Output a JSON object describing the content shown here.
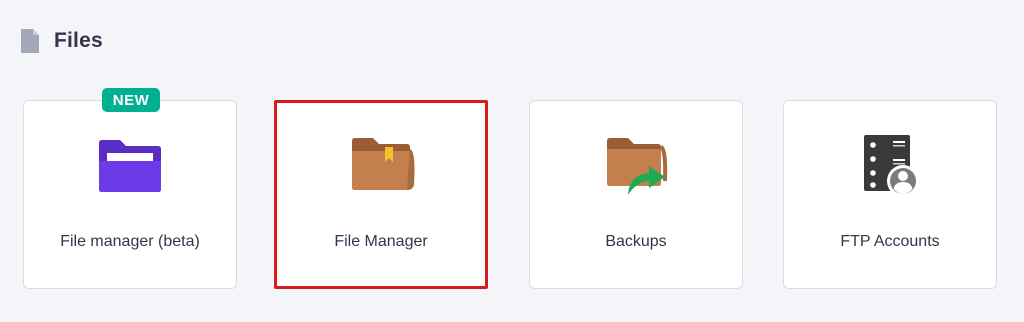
{
  "section": {
    "title": "Files",
    "icon": "document-icon"
  },
  "badge_new": "NEW",
  "cards": [
    {
      "label": "File manager (beta)",
      "icon": "purple-folder-icon"
    },
    {
      "label": "File Manager",
      "icon": "brown-folder-bookmark-icon"
    },
    {
      "label": "Backups",
      "icon": "folder-arrow-icon"
    },
    {
      "label": "FTP Accounts",
      "icon": "server-user-icon"
    }
  ],
  "colors": {
    "badge": "#00b090",
    "highlight_border": "#d61b1b",
    "purple_folder": "#6d3ae8",
    "brown_folder": "#c47f4f",
    "green_arrow": "#1faa52",
    "server": "#3a3a3a"
  }
}
